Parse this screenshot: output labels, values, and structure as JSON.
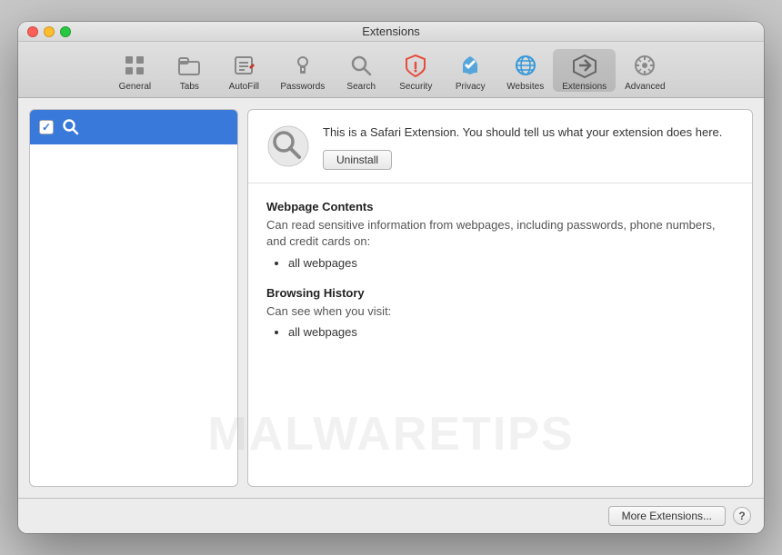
{
  "window": {
    "title": "Extensions"
  },
  "toolbar": {
    "items": [
      {
        "id": "general",
        "label": "General",
        "icon": "⚙"
      },
      {
        "id": "tabs",
        "label": "Tabs",
        "icon": "⬜"
      },
      {
        "id": "autofill",
        "label": "AutoFill",
        "icon": "✏️"
      },
      {
        "id": "passwords",
        "label": "Passwords",
        "icon": "🔑"
      },
      {
        "id": "search",
        "label": "Search",
        "icon": "🔍"
      },
      {
        "id": "security",
        "label": "Security",
        "icon": "🛡"
      },
      {
        "id": "privacy",
        "label": "Privacy",
        "icon": "✋"
      },
      {
        "id": "websites",
        "label": "Websites",
        "icon": "🌐"
      },
      {
        "id": "extensions",
        "label": "Extensions",
        "icon": "⚡",
        "active": true
      },
      {
        "id": "advanced",
        "label": "Advanced",
        "icon": "⚙"
      }
    ]
  },
  "sidebar": {
    "items": [
      {
        "id": "search-ext",
        "checked": true,
        "label": "",
        "selected": true
      }
    ]
  },
  "main": {
    "ext_description": "This is a Safari Extension. You should tell us what your extension does here.",
    "uninstall_label": "Uninstall",
    "permissions": [
      {
        "title": "Webpage Contents",
        "desc": "Can read sensitive information from webpages, including passwords, phone numbers, and credit cards on:",
        "items": [
          "all webpages"
        ]
      },
      {
        "title": "Browsing History",
        "desc": "Can see when you visit:",
        "items": [
          "all webpages"
        ]
      }
    ]
  },
  "footer": {
    "more_extensions_label": "More Extensions...",
    "help_label": "?"
  },
  "watermark": {
    "text": "MALWARETIPS"
  }
}
